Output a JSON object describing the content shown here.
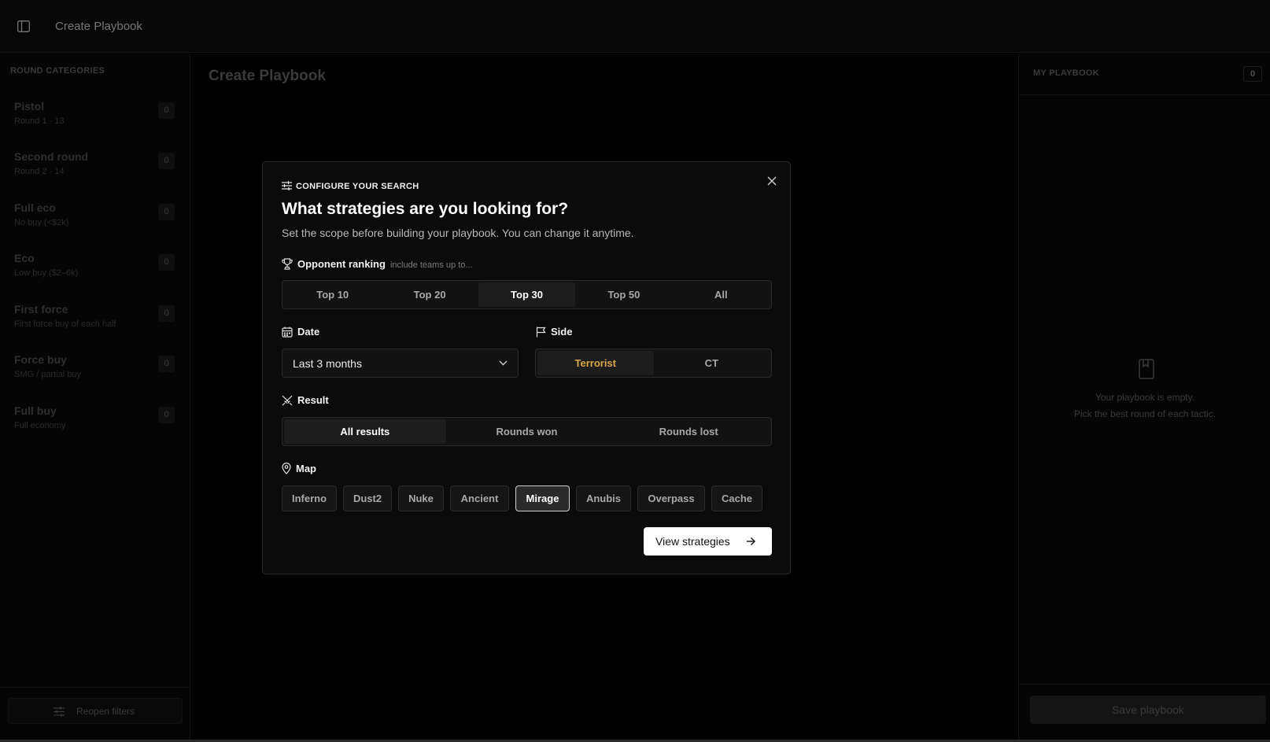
{
  "header": {
    "title": "Create Playbook"
  },
  "sidebar": {
    "heading": "ROUND CATEGORIES",
    "categories": [
      {
        "name": "Pistol",
        "sub": "Round 1 · 13",
        "count": "0"
      },
      {
        "name": "Second round",
        "sub": "Round 2 · 14",
        "count": "0"
      },
      {
        "name": "Full eco",
        "sub": "No buy (<$2k)",
        "count": "0"
      },
      {
        "name": "Eco",
        "sub": "Low buy ($2–6k)",
        "count": "0"
      },
      {
        "name": "First force",
        "sub": "First force buy of each half",
        "count": "0"
      },
      {
        "name": "Force buy",
        "sub": "SMG / partial buy",
        "count": "0"
      },
      {
        "name": "Full buy",
        "sub": "Full economy",
        "count": "0"
      }
    ],
    "reopen_label": "Reopen filters"
  },
  "main": {
    "title": "Create Playbook"
  },
  "playbook": {
    "heading": "MY PLAYBOOK",
    "count": "0",
    "empty_line1": "Your playbook is empty.",
    "empty_line2": "Pick the best round of each tactic.",
    "save_label": "Save playbook"
  },
  "modal": {
    "eyebrow": "CONFIGURE YOUR SEARCH",
    "headline": "What strategies are you looking for?",
    "description": "Set the scope before building your playbook. You can change it anytime.",
    "ranking": {
      "label": "Opponent ranking",
      "hint": "include teams up to...",
      "options": [
        "Top 10",
        "Top 20",
        "Top 30",
        "Top 50",
        "All"
      ],
      "selected": "Top 30"
    },
    "date": {
      "label": "Date",
      "value": "Last 3 months"
    },
    "side": {
      "label": "Side",
      "options": [
        "Terrorist",
        "CT"
      ],
      "selected": "Terrorist"
    },
    "result": {
      "label": "Result",
      "options": [
        "All results",
        "Rounds won",
        "Rounds lost"
      ],
      "selected": "All results"
    },
    "map": {
      "label": "Map",
      "options": [
        "Inferno",
        "Dust2",
        "Nuke",
        "Ancient",
        "Mirage",
        "Anubis",
        "Overpass",
        "Cache"
      ],
      "selected": "Mirage"
    },
    "cta_label": "View strategies"
  },
  "colors": {
    "accent_amber": "#d9a64a",
    "background": "#000000",
    "modal_bg": "#0b0b0b"
  }
}
